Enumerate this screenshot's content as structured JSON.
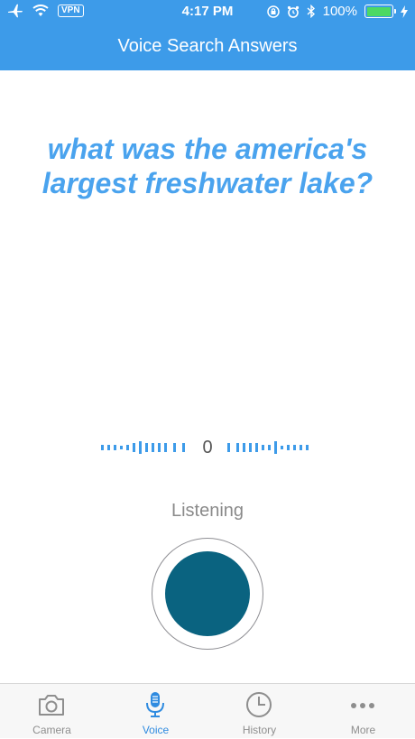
{
  "status_bar": {
    "vpn_label": "VPN",
    "time": "4:17 PM",
    "battery_percent": "100%",
    "battery_level": 1.0,
    "icons": [
      "airplane-icon",
      "wifi-icon",
      "lock-rotation-icon",
      "alarm-icon",
      "bluetooth-icon",
      "charging-icon"
    ]
  },
  "nav": {
    "title": "Voice Search Answers"
  },
  "main": {
    "question": "what was the america's largest freshwater lake?",
    "level_value": "0",
    "status": "Listening"
  },
  "colors": {
    "header": "#3d9be9",
    "question_text": "#4aa3ee",
    "record_button": "#0a6380",
    "active_tab": "#2f8be0",
    "inactive_tab": "#8e8e8e"
  },
  "tabbar": {
    "tabs": [
      {
        "label": "Camera",
        "icon": "camera-icon",
        "active": false
      },
      {
        "label": "Voice",
        "icon": "microphone-icon",
        "active": true
      },
      {
        "label": "History",
        "icon": "clock-icon",
        "active": false
      },
      {
        "label": "More",
        "icon": "more-dots-icon",
        "active": false
      }
    ]
  }
}
